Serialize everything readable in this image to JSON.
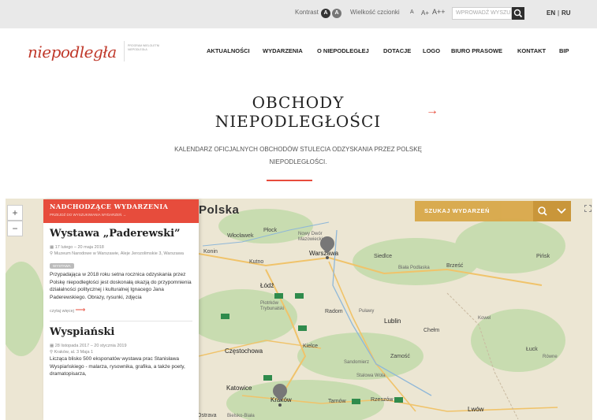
{
  "topbar": {
    "contrast_label": "Kontrast",
    "contrast_a": "A",
    "contrast_b": "A",
    "font_size_label": "Wielkość czcionki",
    "font_a": "A",
    "font_a_plus": "A+",
    "font_a_plus_plus": "A++",
    "search_placeholder": "WPROWADŹ WYSZUK",
    "lang_en": "EN",
    "lang_sep": "|",
    "lang_ru": "RU"
  },
  "header": {
    "logo_text": "niepodległa",
    "logo_subtitle": "PROGRAM WIELOLETNI NIEPODLEGŁA",
    "nav": [
      "AKTUALNOŚCI",
      "WYDARZENIA",
      "O NIEPODLEGŁEJ",
      "DOTACJE",
      "LOGO",
      "BIURO PRASOWE",
      "KONTAKT",
      "BIP"
    ]
  },
  "hero": {
    "title": "OBCHODY NIEPODLEGŁOŚCI",
    "arrow": "→",
    "subtitle": "KALENDARZ OFICJALNYCH OBCHODÓW STULECIA ODZYSKANIA PRZEZ POLSKĘ NIEPODLEGŁOŚCI."
  },
  "map": {
    "country_label": "Polska",
    "zoom_in": "+",
    "zoom_out": "−",
    "search_placeholder": "SZUKAJ WYDARZEŃ",
    "search_icon": "search-icon",
    "dropdown_icon": "chevron-down-icon",
    "cities": {
      "wloclawek": "Włocławek",
      "plock": "Płock",
      "nowy_dwor": "Nowy Dwór Mazowiecki",
      "warszawa": "Warszawa",
      "siedlce": "Siedlce",
      "biala_podlaska": "Biała Podlaska",
      "brzesc": "Brześć",
      "konin": "Konin",
      "kutno": "Kutno",
      "lodz": "Łódź",
      "piotrkow": "Piotrków Trybunalski",
      "radom": "Radom",
      "pulawy": "Puławy",
      "lublin": "Lublin",
      "chelm": "Chełm",
      "czestochowa": "Częstochowa",
      "kielce": "Kielce",
      "zamosc": "Zamość",
      "luck": "Łuck",
      "sandomierz": "Sandomierz",
      "stalowa_wola": "Stalowa Wola",
      "katowice": "Katowice",
      "krakow": "Kraków",
      "tarnow": "Tarnów",
      "rzeszow": "Rzeszów",
      "lwow": "Lwów",
      "ostrava": "Ostrava",
      "bielsko": "Bielsko-Biała",
      "pinsk": "Pińsk",
      "kowel": "Kowel",
      "rowne": "Równe"
    }
  },
  "panel": {
    "heading": "NADCHODZĄCE WYDARZENIA",
    "subheading": "PRZEJDŹ DO WYSZUKIWANIA WYDARZEŃ →",
    "events": [
      {
        "title": "Wystawa „Paderewski”",
        "date": "17 lutego – 20 maja 2018",
        "place": "Muzeum Narodowe w Warszawie, Aleje Jerozolimskie 3, Warszawa",
        "tag": "WYSTAWA",
        "desc": "Przypadająca w 2018 roku setna rocznica odzyskania przez Polskę niepodległości jest doskonałą okazją do przypomnienia działalności politycznej i kulturalnej Ignacego Jana Paderewskiego. Obrazy, rysunki, zdjęcia",
        "more": "czytaj więcej"
      },
      {
        "title": "Wyspiański",
        "date": "28 listopada 2017 – 20 stycznia 2019",
        "place": "Kraków, al. 3 Maja 1",
        "desc": "Licząca blisko 500 eksponatów wystawa prac Stanisława Wyspiańskiego - malarza, rysownika, grafika, a także poety, dramatopisarza,"
      }
    ]
  },
  "colors": {
    "accent": "#e74c3c",
    "map_search": "#d9a84a",
    "map_bg": "#ece6d3",
    "forest": "#c8dcb0"
  }
}
